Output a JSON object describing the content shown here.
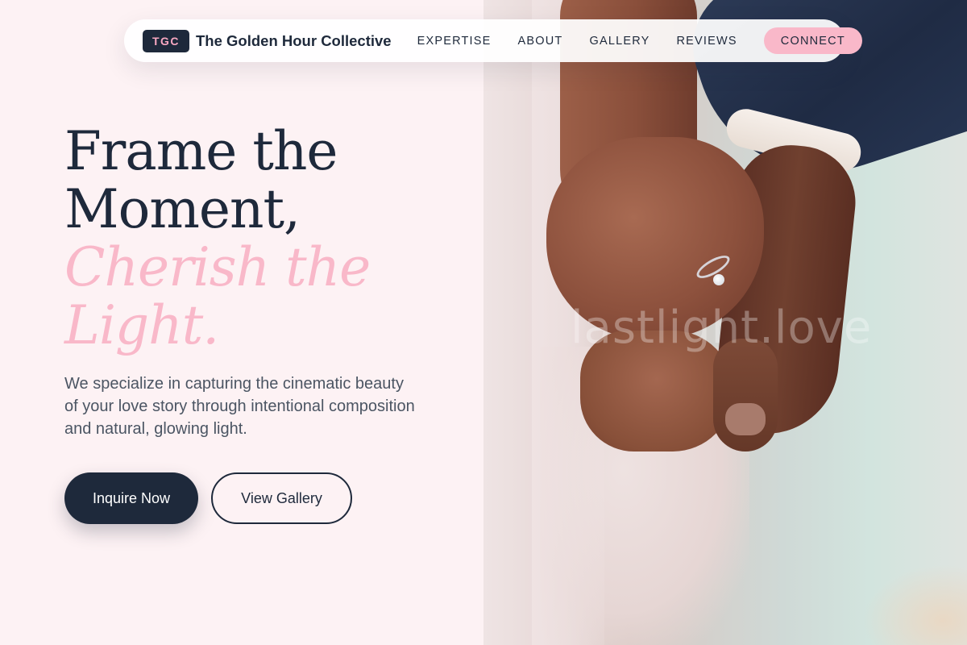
{
  "nav": {
    "badge": "TGC",
    "brand_name": "The Golden Hour Collective",
    "links": [
      "EXPERTISE",
      "ABOUT",
      "GALLERY",
      "REVIEWS"
    ],
    "cta": "CONNECT"
  },
  "hero": {
    "headline_line1": "Frame the",
    "headline_line2": "Moment,",
    "headline_accent_line1": "Cherish the",
    "headline_accent_line2": "Light.",
    "subtitle": "We specialize in capturing the cinematic beauty of your love story through intentional composition and natural, glowing light.",
    "primary_button": "Inquire Now",
    "secondary_button": "View Gallery"
  },
  "photo": {
    "watermark": "lastlight.love"
  },
  "colors": {
    "background": "#fdf2f4",
    "navy": "#1e293b",
    "accent_pink": "#f9b8c9",
    "body_text": "#4b5563"
  }
}
